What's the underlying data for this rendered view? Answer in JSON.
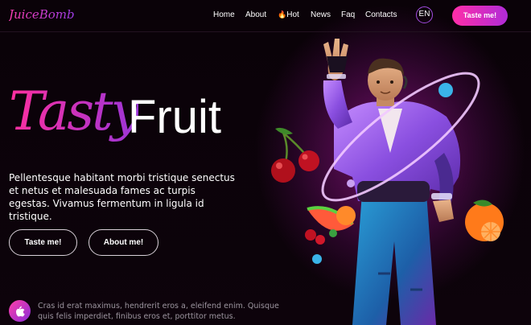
{
  "brand": {
    "logo": "JuiceBomb"
  },
  "nav": {
    "links": [
      "Home",
      "About",
      "Hot",
      "News",
      "Faq",
      "Contacts"
    ],
    "hot_emoji": "🔥",
    "language": "EN",
    "cta": "Taste me!"
  },
  "hero": {
    "title_accent": "Tasty",
    "title_main": "Fruit",
    "description": "Pellentesque habitant morbi tristique senectus et netus et malesuada fames ac turpis egestas. Vivamus fermentum in ligula id tristique.",
    "buttons": {
      "primary": "Taste me!",
      "secondary": "About me!"
    }
  },
  "footer": {
    "note": "Cras id erat maximus, hendrerit eros a, eleifend enim. Quisque quis felis imperdiet, finibus eros et, porttitor metus."
  },
  "colors": {
    "accent_pink": "#ff2ea8",
    "accent_purple": "#9a35d8",
    "background": "#0a0208"
  },
  "icons": {
    "footer_badge": "apple-icon",
    "hero_art": "character-illustration"
  }
}
